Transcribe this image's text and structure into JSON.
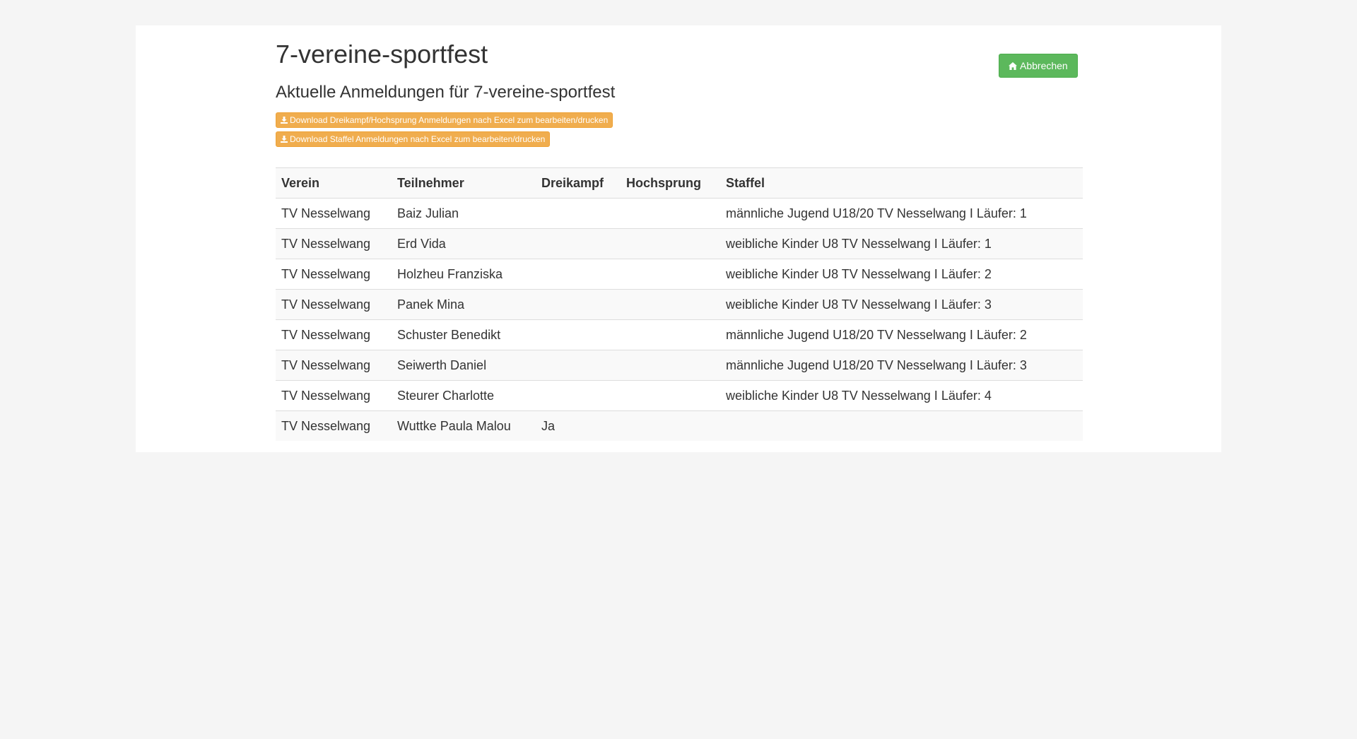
{
  "header": {
    "title": "7-vereine-sportfest",
    "subtitle": "Aktuelle Anmeldungen für 7-vereine-sportfest",
    "cancel_label": "Abbrechen",
    "download_dreikampf_label": "Download Dreikampf/Hochsprung Anmeldungen nach Excel zum bearbeiten/drucken",
    "download_staffel_label": "Download Staffel Anmeldungen nach Excel zum bearbeiten/drucken"
  },
  "icons": {
    "cancel": "home-icon",
    "download": "download-icon"
  },
  "colors": {
    "success": "#5cb85c",
    "warning": "#f0ad4e",
    "background": "#f5f5f5"
  },
  "table": {
    "columns": [
      "Verein",
      "Teilnehmer",
      "Dreikampf",
      "Hochsprung",
      "Staffel"
    ],
    "rows": [
      [
        "TV Nesselwang",
        "Baiz Julian",
        "",
        "",
        "männliche Jugend U18/20 TV Nesselwang I Läufer: 1"
      ],
      [
        "TV Nesselwang",
        "Erd Vida",
        "",
        "",
        "weibliche Kinder U8 TV Nesselwang I Läufer: 1"
      ],
      [
        "TV Nesselwang",
        "Holzheu Franziska",
        "",
        "",
        "weibliche Kinder U8 TV Nesselwang I Läufer: 2"
      ],
      [
        "TV Nesselwang",
        "Panek Mina",
        "",
        "",
        "weibliche Kinder U8 TV Nesselwang I Läufer: 3"
      ],
      [
        "TV Nesselwang",
        "Schuster Benedikt",
        "",
        "",
        "männliche Jugend U18/20 TV Nesselwang I Läufer: 2"
      ],
      [
        "TV Nesselwang",
        "Seiwerth Daniel",
        "",
        "",
        "männliche Jugend U18/20 TV Nesselwang I Läufer: 3"
      ],
      [
        "TV Nesselwang",
        "Steurer Charlotte",
        "",
        "",
        "weibliche Kinder U8 TV Nesselwang I Läufer: 4"
      ],
      [
        "TV Nesselwang",
        "Wuttke Paula Malou",
        "Ja",
        "",
        ""
      ]
    ]
  }
}
